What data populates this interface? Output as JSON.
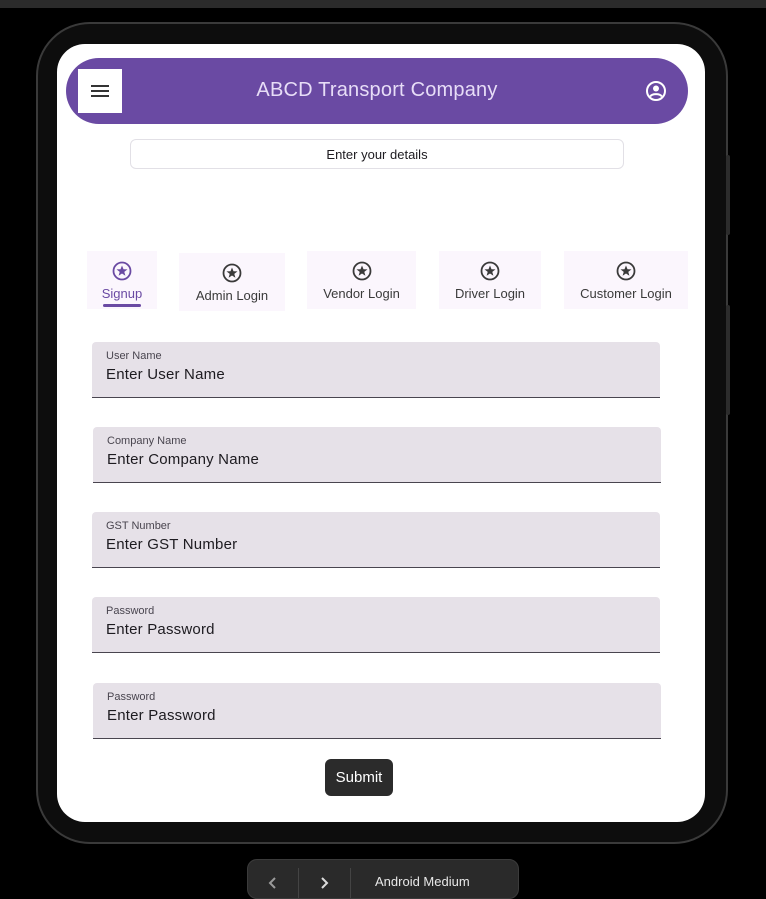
{
  "header": {
    "title": "ABCD Transport Company"
  },
  "subtitle_chip": "Enter your details",
  "tabs": [
    {
      "label": "Signup",
      "active": true
    },
    {
      "label": "Admin Login",
      "active": false
    },
    {
      "label": "Vendor Login",
      "active": false
    },
    {
      "label": "Driver Login",
      "active": false
    },
    {
      "label": "Customer Login",
      "active": false
    }
  ],
  "form": {
    "fields": [
      {
        "label": "User Name",
        "placeholder": "Enter User Name"
      },
      {
        "label": "Company Name",
        "placeholder": "Enter Company Name"
      },
      {
        "label": "GST Number",
        "placeholder": "Enter GST Number"
      },
      {
        "label": "Password",
        "placeholder": "Enter Password"
      },
      {
        "label": "Password",
        "placeholder": "Enter Password"
      }
    ],
    "submit_label": "Submit"
  },
  "device_toolbar": {
    "back_icon": "chevron-left-icon",
    "forward_icon": "chevron-right-icon",
    "device_name": "Android Medium"
  },
  "colors": {
    "primary": "#6a4aa3",
    "appbar_text": "#e7ddf7",
    "field_bg": "#e6e1e8",
    "tab_bg": "#fbf6fd",
    "submit_bg": "#2b2b2b"
  },
  "icons": {
    "menu": "hamburger-menu-icon",
    "account": "account-circle-icon",
    "tab": "star-circle-icon"
  }
}
